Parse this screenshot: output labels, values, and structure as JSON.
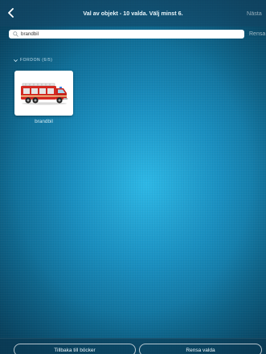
{
  "nav": {
    "title": "Val av objekt - 10 valda. Välj minst 6.",
    "next_label": "Nästa"
  },
  "search": {
    "value": "brandbil",
    "clear_label": "Rensa"
  },
  "section": {
    "header": "FORDON (6/5)"
  },
  "items": [
    {
      "label": "brandbil",
      "icon": "fire-truck"
    }
  ],
  "footer": {
    "back_label": "Tillbaka till böcker",
    "clear_selected_label": "Rensa valda"
  },
  "colors": {
    "background": "#1a8fc0",
    "truck_red": "#d42a22"
  }
}
